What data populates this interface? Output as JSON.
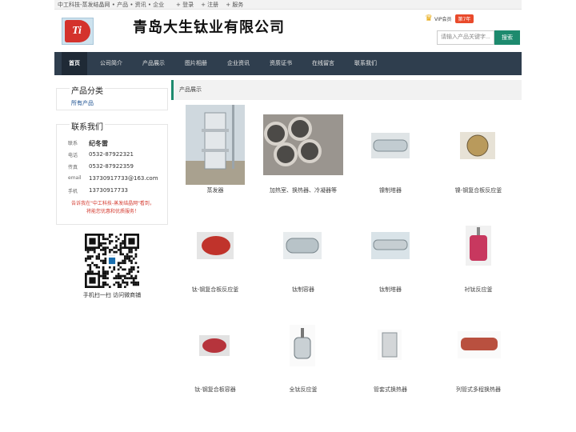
{
  "topbar": {
    "breadcrumb": "中工科技-蒸发结晶网 • 产品 • 资讯 • 企业",
    "links": [
      "+ 登录",
      "+ 注册",
      "+ 服务"
    ]
  },
  "header": {
    "logo_text": "Ti",
    "company_name": "青岛大生钛业有限公司",
    "vip_label": "VIP会员",
    "vip_years": "第7年",
    "search_placeholder": "请输入产品关键字...",
    "search_button": "搜索"
  },
  "nav": {
    "items": [
      "首页",
      "公司简介",
      "产品展示",
      "图片相册",
      "企业资讯",
      "资质证书",
      "在线留言",
      "联系我们"
    ]
  },
  "sidebar": {
    "category_title": "产品分类",
    "all_products": "所有产品",
    "contact_title": "联系我们",
    "contacts": [
      {
        "label": "联系",
        "value": "纪冬雷"
      },
      {
        "label": "电话",
        "value": "0532-87922321"
      },
      {
        "label": "传真",
        "value": "0532-87922359"
      },
      {
        "label": "email",
        "value": "13730917733@163.com"
      },
      {
        "label": "手机",
        "value": "13730917733"
      }
    ],
    "note_line1": "告诉我在\"中工科技-蒸发结晶网\"看到，",
    "note_line2": "将能您优惠和优质服务！",
    "qr_caption": "手机扫一扫 访问微商铺"
  },
  "main": {
    "section_title": "产品展示",
    "products": [
      {
        "name": "蒸发器"
      },
      {
        "name": "加热室、换热器、冷凝器等"
      },
      {
        "name": "镍制塔器"
      },
      {
        "name": "镍-钢复合板反应釜"
      },
      {
        "name": "钛-钢复合板反应釜"
      },
      {
        "name": "钛制容器"
      },
      {
        "name": "钛制塔器"
      },
      {
        "name": "衬钛反应釜"
      },
      {
        "name": "钛-钢复合板容器"
      },
      {
        "name": "全钛反应釜"
      },
      {
        "name": "管套式换热器"
      },
      {
        "name": "列管式多程换热器"
      }
    ]
  },
  "colors": {
    "nav_bg": "#2f3e4e",
    "accent": "#1d8a6e",
    "note_red": "#d43a2f"
  }
}
